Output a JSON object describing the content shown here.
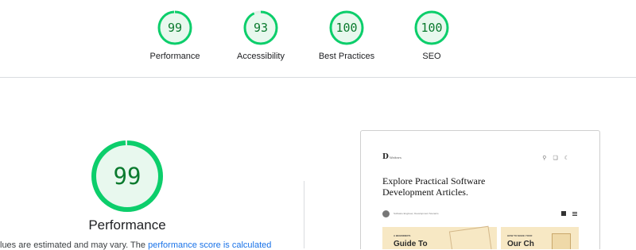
{
  "summary": [
    {
      "name": "Performance",
      "score": 99
    },
    {
      "name": "Accessibility",
      "score": 93
    },
    {
      "name": "Best Practices",
      "score": 100
    },
    {
      "name": "SEO",
      "score": 100
    }
  ],
  "colors": {
    "pass": "#0cce6b",
    "pass_text": "#0a7a2e",
    "pass_fill": "#e8f8ee",
    "track": "#e5efe8"
  },
  "detail": {
    "score": 99,
    "title": "Performance",
    "note_prefix": "lues are estimated and may vary. The ",
    "note_link": "performance score is calculated"
  },
  "preview": {
    "logo": "D",
    "logo_sub": "Writers",
    "icons": [
      "search-icon",
      "copy-icon",
      "moon-icon"
    ],
    "heading": "Explore Practical Software Development Articles.",
    "author_text": "Software Engineer, Development Scenario",
    "card1_sub": "A BEGINNER'S",
    "card1_title": "Guide To",
    "card2_sub": "HOW TO MAKE YOUR",
    "card2_title": "Our Ch"
  }
}
